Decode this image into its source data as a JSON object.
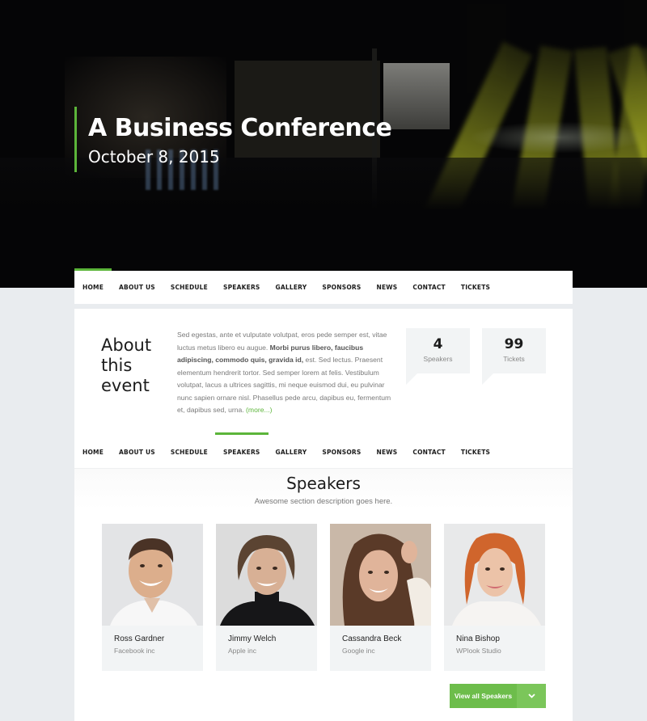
{
  "hero": {
    "title": "A Business Conference",
    "date": "October 8, 2015",
    "accent_color": "#5cb53a"
  },
  "nav_primary": {
    "items": [
      "HOME",
      "ABOUT US",
      "SCHEDULE",
      "SPEAKERS",
      "GALLERY",
      "SPONSORS",
      "NEWS",
      "CONTACT",
      "TICKETS"
    ],
    "active": "HOME"
  },
  "about": {
    "title": "About this event",
    "title_lines": [
      "About",
      "this",
      "event"
    ],
    "text_before_bold": "Sed egestas, ante et vulputate volutpat, eros pede semper est, vitae luctus metus libero eu augue. ",
    "text_bold": "Morbi purus libero, faucibus adipiscing, commodo quis, gravida id,",
    "text_after_bold": " est. Sed lectus. Praesent elementum hendrerit tortor. Sed semper lorem at felis. Vestibulum volutpat, lacus a ultrices sagittis, mi neque euismod dui, eu pulvinar nunc sapien ornare nisl. Phasellus pede arcu, dapibus eu, fermentum et, dapibus sed, urna. ",
    "more_link": "(more...)",
    "stats": [
      {
        "value": "4",
        "label": "Speakers"
      },
      {
        "value": "99",
        "label": "Tickets"
      }
    ]
  },
  "nav_secondary": {
    "items": [
      "HOME",
      "ABOUT US",
      "SCHEDULE",
      "SPEAKERS",
      "GALLERY",
      "SPONSORS",
      "NEWS",
      "CONTACT",
      "TICKETS"
    ],
    "active": "SPEAKERS"
  },
  "speakers": {
    "title": "Speakers",
    "description": "Awesome section description goes here.",
    "list": [
      {
        "name": "Ross Gardner",
        "company": "Facebook inc"
      },
      {
        "name": "Jimmy Welch",
        "company": "Apple inc"
      },
      {
        "name": "Cassandra Beck",
        "company": "Google inc"
      },
      {
        "name": "Nina Bishop",
        "company": "WPlook Studio"
      }
    ],
    "view_all_label": "View all Speakers",
    "button_color": "#6dbd4b"
  }
}
